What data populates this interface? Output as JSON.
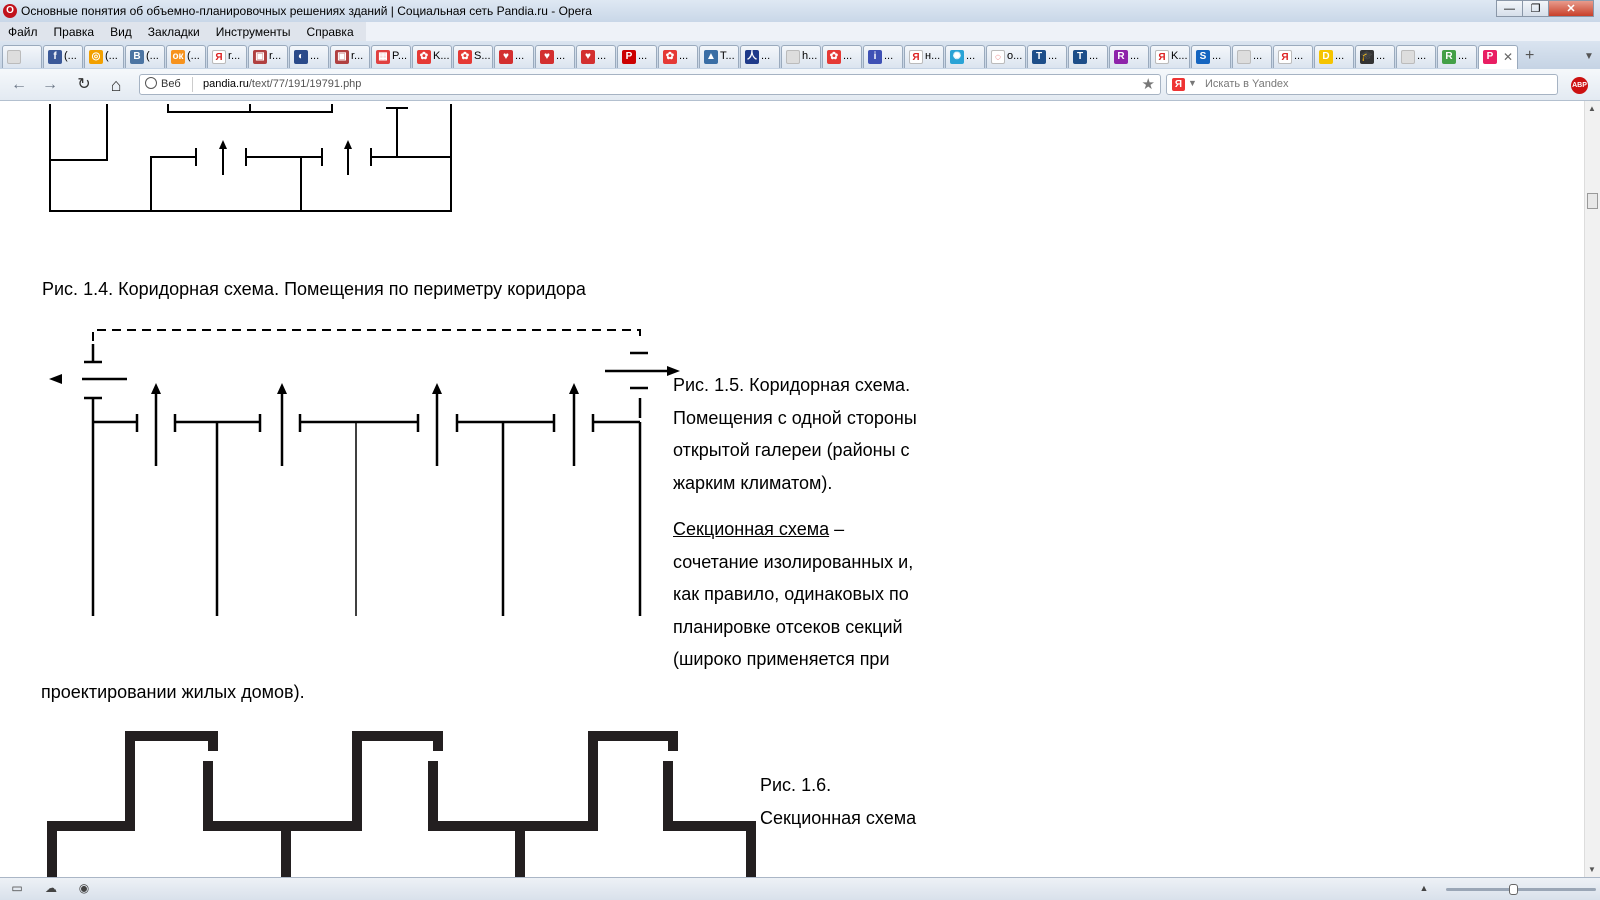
{
  "window": {
    "title": "Основные понятия об объемно-планировочных решениях зданий | Социальная сеть Pandia.ru - Opera",
    "controls": [
      "—",
      "❐",
      "✕"
    ]
  },
  "menu": [
    "Файл",
    "Правка",
    "Вид",
    "Закладки",
    "Инструменты",
    "Справка"
  ],
  "tabs": [
    {
      "label": "",
      "icon": "page-icon",
      "color": "#dddddd",
      "glyph": ""
    },
    {
      "label": "(...",
      "icon": "facebook-icon",
      "color": "#3b5998",
      "glyph": "f"
    },
    {
      "label": "(...",
      "icon": "odnoklassniki-ring-icon",
      "color": "#f2a000",
      "glyph": "◎"
    },
    {
      "label": "(...",
      "icon": "vk-icon",
      "color": "#4c75a3",
      "glyph": "B"
    },
    {
      "label": "(...",
      "icon": "odnoklassniki-icon",
      "color": "#f7931e",
      "glyph": "ок"
    },
    {
      "label": "r...",
      "icon": "yandex-icon",
      "color": "#ffffff",
      "glyph": "Я"
    },
    {
      "label": "r...",
      "icon": "image-icon",
      "color": "#b04040",
      "glyph": "▣"
    },
    {
      "label": "...",
      "icon": "compass-icon",
      "color": "#2a4a8a",
      "glyph": "◐"
    },
    {
      "label": "r...",
      "icon": "image-icon",
      "color": "#b04040",
      "glyph": "▣"
    },
    {
      "label": "P...",
      "icon": "grid-icon",
      "color": "#e04040",
      "glyph": "▦"
    },
    {
      "label": "K...",
      "icon": "flower-icon",
      "color": "#e53935",
      "glyph": "✿"
    },
    {
      "label": "S...",
      "icon": "flower-icon",
      "color": "#e53935",
      "glyph": "✿"
    },
    {
      "label": "...",
      "icon": "shield-icon",
      "color": "#d32f2f",
      "glyph": "♥"
    },
    {
      "label": "...",
      "icon": "shield-icon",
      "color": "#d32f2f",
      "glyph": "♥"
    },
    {
      "label": "...",
      "icon": "shield-icon",
      "color": "#d32f2f",
      "glyph": "♥"
    },
    {
      "label": "...",
      "icon": "red-logo-icon",
      "color": "#cc0000",
      "glyph": "P"
    },
    {
      "label": "...",
      "icon": "flower-icon",
      "color": "#e53935",
      "glyph": "✿"
    },
    {
      "label": "T...",
      "icon": "mountain-icon",
      "color": "#3a6ea5",
      "glyph": "▲"
    },
    {
      "label": "...",
      "icon": "person-icon",
      "color": "#1e3a8a",
      "glyph": "人"
    },
    {
      "label": "h...",
      "icon": "page-icon",
      "color": "#dddddd",
      "glyph": ""
    },
    {
      "label": "...",
      "icon": "flower-icon",
      "color": "#e53935",
      "glyph": "✿"
    },
    {
      "label": "...",
      "icon": "info-icon",
      "color": "#3f51b5",
      "glyph": "i"
    },
    {
      "label": "н...",
      "icon": "yandex-icon",
      "color": "#ffffff",
      "glyph": "Я"
    },
    {
      "label": "...",
      "icon": "gear-icon",
      "color": "#29a3d6",
      "glyph": "✺"
    },
    {
      "label": "o...",
      "icon": "loading-icon",
      "color": "#ffffff",
      "glyph": "◌"
    },
    {
      "label": "...",
      "icon": "t-icon",
      "color": "#1d4e89",
      "glyph": "T"
    },
    {
      "label": "...",
      "icon": "t-icon",
      "color": "#1d4e89",
      "glyph": "T"
    },
    {
      "label": "...",
      "icon": "r-icon",
      "color": "#8e24aa",
      "glyph": "R"
    },
    {
      "label": "K...",
      "icon": "yandex-icon",
      "color": "#ffffff",
      "glyph": "Я"
    },
    {
      "label": "...",
      "icon": "s-icon",
      "color": "#1565c0",
      "glyph": "S"
    },
    {
      "label": "...",
      "icon": "page-icon",
      "color": "#dddddd",
      "glyph": ""
    },
    {
      "label": "...",
      "icon": "yandex-icon",
      "color": "#ffffff",
      "glyph": "Я"
    },
    {
      "label": "...",
      "icon": "d-icon",
      "color": "#f5c400",
      "glyph": "D"
    },
    {
      "label": "...",
      "icon": "graduation-cap-icon",
      "color": "#333333",
      "glyph": "🎓"
    },
    {
      "label": "...",
      "icon": "page-icon",
      "color": "#dddddd",
      "glyph": ""
    },
    {
      "label": "...",
      "icon": "r-icon",
      "color": "#43a047",
      "glyph": "R"
    },
    {
      "label": "",
      "icon": "pandia-icon",
      "color": "#e91e63",
      "glyph": "P",
      "active": true
    }
  ],
  "nav": {
    "back": "←",
    "forward": "→",
    "reload": "↻",
    "home": "⌂",
    "security_badge": "Веб",
    "url_host": "pandia.ru",
    "url_path": "/text/77/191/19791.php",
    "search_placeholder": "Искать в Yandex",
    "adblock": "ABP"
  },
  "content": {
    "fig14_caption": "Рис. 1.4. Коридорная схема. Помещения по периметру коридора",
    "fig15_caption_lines": [
      "Рис. 1.5. Коридорная схема.",
      "Помещения с одной стороны",
      "открытой галереи (районы с",
      "жарким климатом)."
    ],
    "section_term": "Секционная схема",
    "section_def_rest": " –",
    "section_def_lines": [
      "сочетание изолированных и,",
      "как правило, одинаковых по",
      "планировке отсеков секций",
      "(широко применяется при"
    ],
    "section_def_last": "проектировании жилых домов).",
    "fig16_caption_lines": [
      "Рис. 1.6.",
      "Секционная схема"
    ]
  },
  "colors": {
    "diagram_line": "#000000",
    "section_wall": "#231f20"
  }
}
